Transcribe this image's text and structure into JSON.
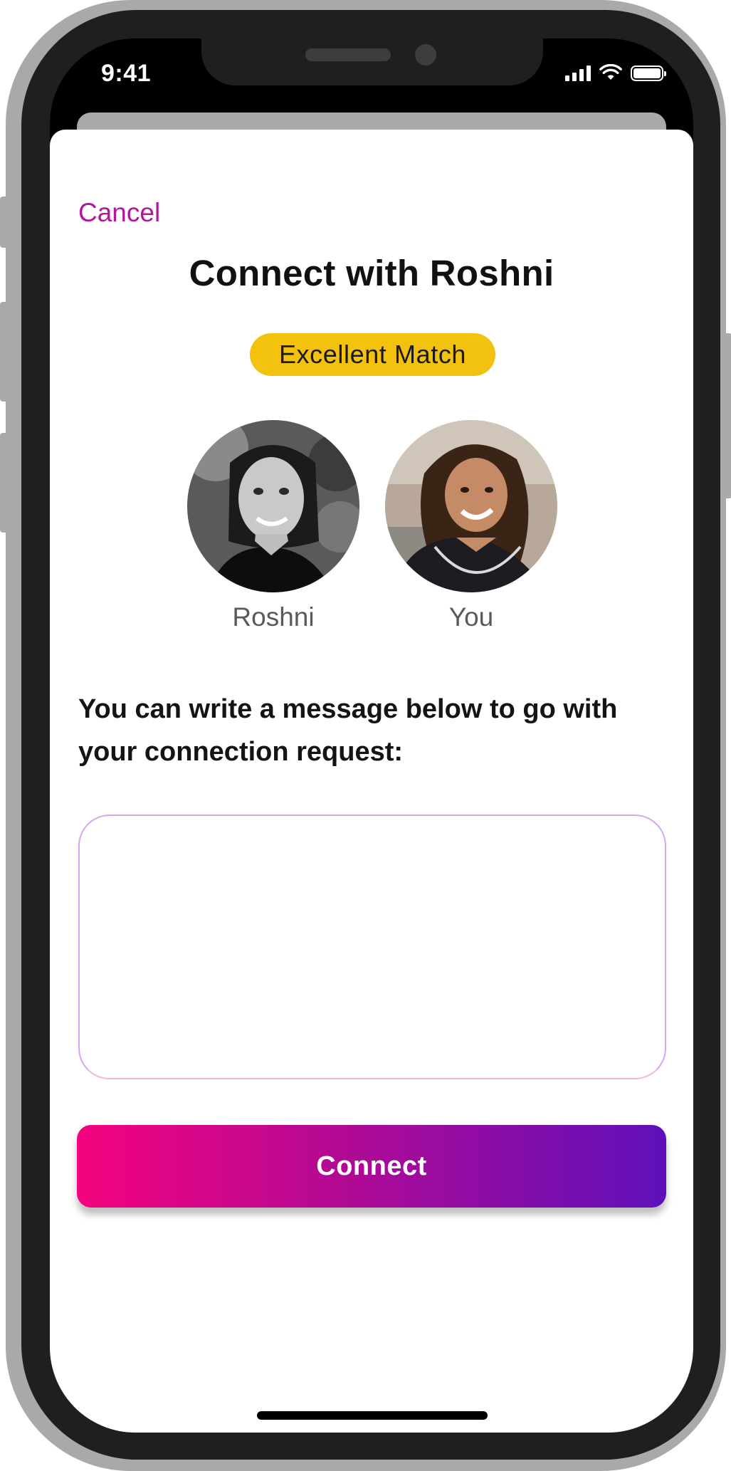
{
  "status_bar": {
    "time": "9:41"
  },
  "modal": {
    "cancel_label": "Cancel",
    "title": "Connect with Roshni",
    "match_badge": "Excellent Match",
    "match_badge_color": "#f2c20f",
    "avatars": [
      {
        "label": "Roshni",
        "style": "grayscale"
      },
      {
        "label": "You",
        "style": "color"
      }
    ],
    "prompt": "You can write a message below to go with your connection request:",
    "message_input": {
      "value": "",
      "placeholder": ""
    },
    "connect_label": "Connect"
  },
  "colors": {
    "accent": "#b4169b",
    "button_gradient_start": "#f4037e",
    "button_gradient_end": "#5e10ba"
  }
}
